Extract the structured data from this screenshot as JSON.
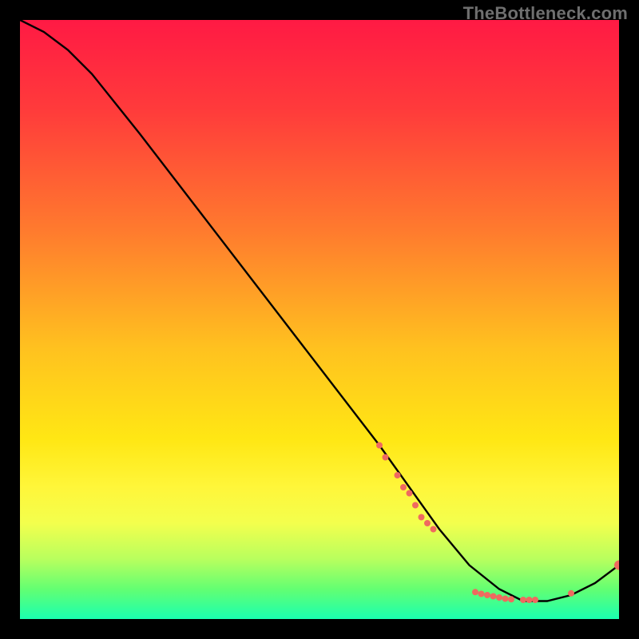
{
  "watermark": "TheBottleneck.com",
  "chart_data": {
    "type": "line",
    "title": "",
    "xlabel": "",
    "ylabel": "",
    "xlim": [
      0,
      100
    ],
    "ylim": [
      0,
      100
    ],
    "grid": false,
    "legend": false,
    "background_gradient": {
      "stops": [
        {
          "offset": 0.0,
          "color": "#ff1a44"
        },
        {
          "offset": 0.15,
          "color": "#ff3b3b"
        },
        {
          "offset": 0.35,
          "color": "#ff7a2e"
        },
        {
          "offset": 0.55,
          "color": "#ffc21f"
        },
        {
          "offset": 0.7,
          "color": "#ffe714"
        },
        {
          "offset": 0.78,
          "color": "#fff63a"
        },
        {
          "offset": 0.84,
          "color": "#f3ff4d"
        },
        {
          "offset": 0.9,
          "color": "#b8ff5e"
        },
        {
          "offset": 0.95,
          "color": "#63ff72"
        },
        {
          "offset": 1.0,
          "color": "#1affb0"
        }
      ]
    },
    "series": [
      {
        "name": "curve",
        "color": "#000000",
        "x": [
          0,
          4,
          8,
          12,
          20,
          30,
          40,
          50,
          60,
          65,
          70,
          75,
          80,
          84,
          88,
          92,
          96,
          100
        ],
        "values": [
          100,
          98,
          95,
          91,
          81,
          68,
          55,
          42,
          29,
          22,
          15,
          9,
          5,
          3,
          3,
          4,
          6,
          9
        ]
      }
    ],
    "markers": {
      "color": "#ef6a5f",
      "radius_small": 4,
      "radius_large": 6,
      "points": [
        {
          "x": 60,
          "y": 29,
          "r": "small"
        },
        {
          "x": 61,
          "y": 27,
          "r": "small"
        },
        {
          "x": 63,
          "y": 24,
          "r": "small"
        },
        {
          "x": 64,
          "y": 22,
          "r": "small"
        },
        {
          "x": 65,
          "y": 21,
          "r": "small"
        },
        {
          "x": 66,
          "y": 19,
          "r": "small"
        },
        {
          "x": 67,
          "y": 17,
          "r": "small"
        },
        {
          "x": 68,
          "y": 16,
          "r": "small"
        },
        {
          "x": 69,
          "y": 15,
          "r": "small"
        },
        {
          "x": 76,
          "y": 4.5,
          "r": "small"
        },
        {
          "x": 77,
          "y": 4.2,
          "r": "small"
        },
        {
          "x": 78,
          "y": 4.0,
          "r": "small"
        },
        {
          "x": 79,
          "y": 3.8,
          "r": "small"
        },
        {
          "x": 80,
          "y": 3.6,
          "r": "small"
        },
        {
          "x": 81,
          "y": 3.4,
          "r": "small"
        },
        {
          "x": 82,
          "y": 3.3,
          "r": "small"
        },
        {
          "x": 84,
          "y": 3.2,
          "r": "small"
        },
        {
          "x": 85,
          "y": 3.2,
          "r": "small"
        },
        {
          "x": 86,
          "y": 3.2,
          "r": "small"
        },
        {
          "x": 92,
          "y": 4.3,
          "r": "small"
        },
        {
          "x": 100,
          "y": 9,
          "r": "large"
        }
      ]
    }
  }
}
